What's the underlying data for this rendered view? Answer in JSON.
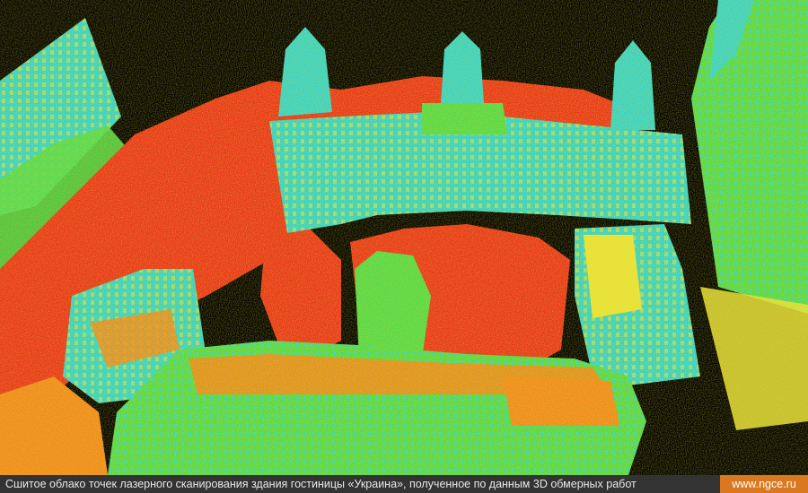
{
  "caption": {
    "text": "Сшитое облако точек лазерного сканирования здания гостиницы «Украина», полученное по данным 3D обмерных работ",
    "link": "www.ngce.ru"
  },
  "colors": {
    "background": "#000000",
    "cloud_red": "#e8351c",
    "cloud_orange": "#f08a1e",
    "cloud_yellow": "#e9e23a",
    "cloud_green": "#56d84a",
    "cloud_cyan": "#37d2c8",
    "caption_bg": "#333333",
    "link_bg": "#d9781f"
  }
}
